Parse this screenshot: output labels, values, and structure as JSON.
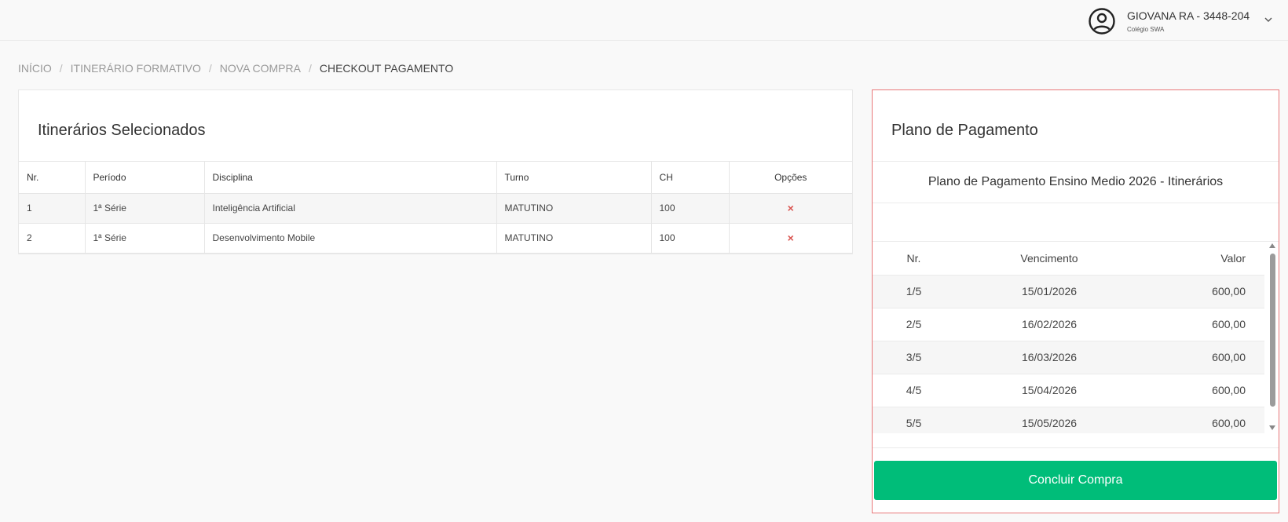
{
  "header": {
    "user_name": "GIOVANA RA - 3448-204",
    "school": "Colégio SWA"
  },
  "breadcrumb": [
    "INÍCIO",
    "ITINERÁRIO FORMATIVO",
    "NOVA COMPRA",
    "CHECKOUT PAGAMENTO"
  ],
  "selected": {
    "title": "Itinerários Selecionados",
    "columns": [
      "Nr.",
      "Período",
      "Disciplina",
      "Turno",
      "CH",
      "Opções"
    ],
    "rows": [
      [
        "1",
        "1ª Série",
        "Inteligência Artificial",
        "MATUTINO",
        "100"
      ],
      [
        "2",
        "1ª Série",
        "Desenvolvimento Mobile",
        "MATUTINO",
        "100"
      ]
    ],
    "remove_icon": "×"
  },
  "payment": {
    "title": "Plano de Pagamento",
    "plan_name": "Plano de Pagamento Ensino Medio 2026 - Itinerários",
    "columns": [
      "Nr.",
      "Vencimento",
      "Valor"
    ],
    "installments": [
      [
        "1/5",
        "15/01/2026",
        "600,00"
      ],
      [
        "2/5",
        "16/02/2026",
        "600,00"
      ],
      [
        "3/5",
        "16/03/2026",
        "600,00"
      ],
      [
        "4/5",
        "15/04/2026",
        "600,00"
      ],
      [
        "5/5",
        "15/05/2026",
        "600,00"
      ]
    ],
    "button_label": "Concluir Compra",
    "button_color": "#00bd79",
    "border_color": "#e9787a"
  }
}
